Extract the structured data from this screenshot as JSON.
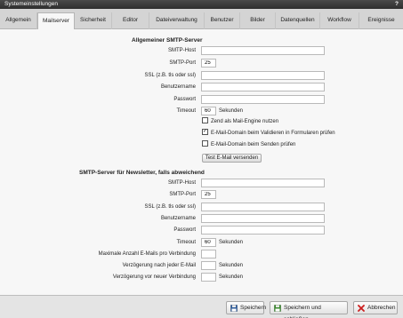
{
  "window": {
    "title": "Systemeinstellungen",
    "help": "?"
  },
  "tabs": [
    {
      "label": "Allgemein"
    },
    {
      "label": "Mailserver"
    },
    {
      "label": "Sicherheit"
    },
    {
      "label": "Editor"
    },
    {
      "label": "Dateiverwaltung"
    },
    {
      "label": "Benutzer"
    },
    {
      "label": "Bilder"
    },
    {
      "label": "Datenquellen"
    },
    {
      "label": "Workflow"
    },
    {
      "label": "Ereignisse"
    }
  ],
  "smtp": {
    "title": "Allgemeiner SMTP-Server",
    "host_label": "SMTP-Host",
    "host_value": "",
    "port_label": "SMTP-Port",
    "port_value": "25",
    "ssl_label": "SSL (z.B. tls oder ssl)",
    "ssl_value": "",
    "user_label": "Benutzername",
    "user_value": "",
    "pass_label": "Passwort",
    "pass_value": "",
    "timeout_label": "Timeout",
    "timeout_value": "60",
    "timeout_unit": "Sekunden",
    "zend_label": "Zend als Mail-Engine nutzen",
    "zend_checked": false,
    "validate_label": "E-Mail-Domain beim Validieren in Formularen prüfen",
    "validate_checked": true,
    "send_check_label": "E-Mail-Domain beim Senden prüfen",
    "send_check_checked": false,
    "test_button": "Test E-Mail versenden"
  },
  "newsletter": {
    "title": "SMTP-Server für Newsletter, falls abweichend",
    "host_label": "SMTP-Host",
    "host_value": "",
    "port_label": "SMTP-Port",
    "port_value": "25",
    "ssl_label": "SSL (z.B. tls oder ssl)",
    "ssl_value": "",
    "user_label": "Benutzername",
    "user_value": "",
    "pass_label": "Passwort",
    "pass_value": "",
    "timeout_label": "Timeout",
    "timeout_value": "60",
    "timeout_unit": "Sekunden",
    "max_label": "Maximale Anzahl E-Mails pro Verbindung",
    "max_value": "",
    "delay_label": "Verzögerung nach jeder E-Mail",
    "delay_value": "",
    "delay_unit": "Sekunden",
    "reconnect_label": "Verzögerung vor neuer Verbindung",
    "reconnect_value": "",
    "reconnect_unit": "Sekunden"
  },
  "footer": {
    "save": "Speichern",
    "save_close": "Speichern und schließen",
    "cancel": "Abbrechen"
  },
  "colors": {
    "save_icon": "#2f5d9c",
    "save_close_icon": "#3a8a2e",
    "cancel_icon": "#cc1f1f"
  }
}
